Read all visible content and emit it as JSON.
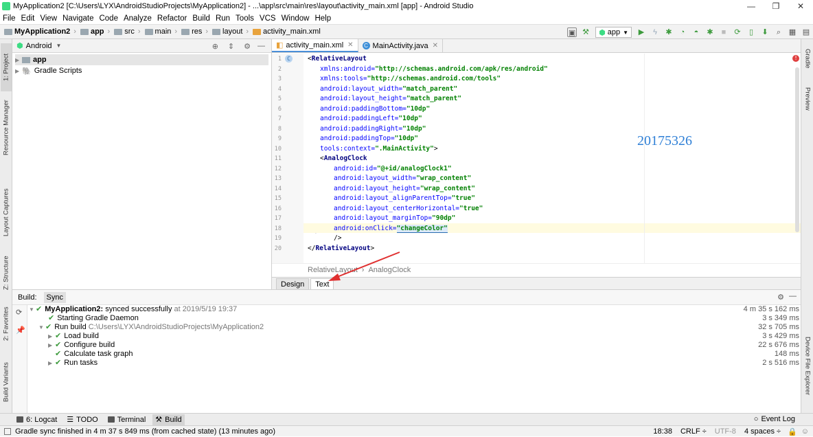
{
  "window": {
    "title": "MyApplication2 [C:\\Users\\LYX\\AndroidStudioProjects\\MyApplication2] - ...\\app\\src\\main\\res\\layout\\activity_main.xml [app] - Android Studio",
    "minimize": "—",
    "maximize": "❐",
    "close": "✕"
  },
  "menu": [
    "File",
    "Edit",
    "View",
    "Navigate",
    "Code",
    "Analyze",
    "Refactor",
    "Build",
    "Run",
    "Tools",
    "VCS",
    "Window",
    "Help"
  ],
  "breadcrumb": [
    "MyApplication2",
    "app",
    "src",
    "main",
    "res",
    "layout",
    "activity_main.xml"
  ],
  "toolbar": {
    "run_config": "app"
  },
  "left_strip": [
    "1: Project",
    "Resource Manager",
    "Layout Captures",
    "Z: Structure",
    "2: Favorites",
    "Build Variants"
  ],
  "right_strip": [
    "Gradle",
    "Preview",
    "Device File Explorer"
  ],
  "project": {
    "view": "Android",
    "tree": [
      "app",
      "Gradle Scripts"
    ]
  },
  "editor": {
    "tabs": [
      "activity_main.xml",
      "MainActivity.java"
    ],
    "line_numbers": [
      "1",
      "2",
      "3",
      "4",
      "5",
      "6",
      "7",
      "8",
      "9",
      "10",
      "11",
      "12",
      "13",
      "14",
      "15",
      "16",
      "17",
      "18",
      "19",
      "20"
    ],
    "overlay_number": "20175326",
    "structure_breadcrumb": [
      "RelativeLayout",
      "AnalogClock"
    ],
    "design_tabs": [
      "Design",
      "Text"
    ]
  },
  "code": {
    "l1": "RelativeLayout",
    "l2a": "xmlns:android=",
    "l2b": "\"http://schemas.android.com/apk/res/android\"",
    "l3a": "xmlns:tools=",
    "l3b": "\"http://schemas.android.com/tools\"",
    "l4a": "android:layout_width=",
    "l4b": "\"match_parent\"",
    "l5a": "android:layout_height=",
    "l5b": "\"match_parent\"",
    "l6a": "android:paddingBottom=",
    "l6b": "\"10dp\"",
    "l7a": "android:paddingLeft=",
    "l7b": "\"10dp\"",
    "l8a": "android:paddingRight=",
    "l8b": "\"10dp\"",
    "l9a": "android:paddingTop=",
    "l9b": "\"10dp\"",
    "l10a": "tools:context=",
    "l10b": "\".MainActivity\"",
    "l11": "AnalogClock",
    "l12a": "android:id=",
    "l12b": "\"@+id/analogClock1\"",
    "l13a": "android:layout_width=",
    "l13b": "\"wrap_content\"",
    "l14a": "android:layout_height=",
    "l14b": "\"wrap_content\"",
    "l15a": "android:layout_alignParentTop=",
    "l15b": "\"true\"",
    "l16a": "android:layout_centerHorizontal=",
    "l16b": "\"true\"",
    "l17a": "android:layout_marginTop=",
    "l17b": "\"90dp\"",
    "l18a": "android:onClick=",
    "l18b": "\"changeColor\"",
    "l19": "/>",
    "l20": "RelativeLayout"
  },
  "build": {
    "tabs": [
      "Build:",
      "Sync"
    ],
    "rows": [
      {
        "label": "MyApplication2:",
        "text": "synced successfully",
        "meta": "at 2019/5/19 19:37",
        "time": "4 m 35 s 162 ms"
      },
      {
        "label": "Starting Gradle Daemon",
        "time": "3 s 349 ms"
      },
      {
        "label": "Run build",
        "meta": "C:\\Users\\LYX\\AndroidStudioProjects\\MyApplication2",
        "time": "32 s 705 ms"
      },
      {
        "label": "Load build",
        "time": "3 s 429 ms"
      },
      {
        "label": "Configure build",
        "time": "22 s 676 ms"
      },
      {
        "label": "Calculate task graph",
        "time": "148 ms"
      },
      {
        "label": "Run tasks",
        "time": "2 s 516 ms"
      }
    ]
  },
  "bottom_tabs": [
    "6: Logcat",
    "TODO",
    "Terminal",
    "Build"
  ],
  "event_log": "Event Log",
  "status": {
    "message": "Gradle sync finished in 4 m 37 s 849 ms (from cached state) (13 minutes ago)",
    "position": "18:38",
    "line_sep": "CRLF ÷",
    "encoding": "UTF-8",
    "indent": "4 spaces ÷"
  }
}
